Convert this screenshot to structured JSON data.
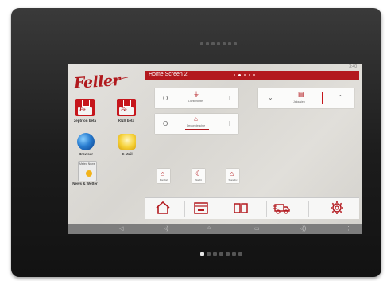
{
  "device": {
    "status_clock": "3:40"
  },
  "launcher": {
    "logo_text": "Feller",
    "apps": [
      {
        "name": "zeptrion beta",
        "icon": "feller-home-app-icon"
      },
      {
        "name": "KNX beta",
        "icon": "feller-home-app-icon"
      },
      {
        "name": "Browser",
        "icon": "globe-icon"
      },
      {
        "name": "E-Mail",
        "icon": "mail-icon"
      },
      {
        "name": "News & Wetter",
        "icon": "weather-icon"
      }
    ],
    "weather_widget_caption": "Meteo News"
  },
  "home_screen": {
    "title": "Home Screen 2",
    "page_count": 5,
    "active_page": 2,
    "colors": {
      "accent": "#b3191e",
      "header": "#b3191e"
    },
    "light_cards": [
      {
        "off_symbol": "O",
        "on_symbol": "I",
        "label": "Lichterkette",
        "icon": "light-fixture-icon"
      },
      {
        "off_symbol": "O",
        "on_symbol": "I",
        "label": "Deckenleuchte",
        "icon": "ceiling-lamp-icon"
      }
    ],
    "blind_card": {
      "down_symbol": "⌄",
      "up_symbol": "⌃",
      "label": "Jalousien",
      "icon": "blinds-icon"
    },
    "scenes": [
      {
        "label": "Komfort",
        "icon": "house-icon"
      },
      {
        "label": "Nacht",
        "icon": "moon-icon"
      },
      {
        "label": "Standby",
        "icon": "house-outline-icon"
      }
    ],
    "bottom_nav": [
      {
        "name": "home",
        "icon": "home-icon"
      },
      {
        "name": "calendar",
        "icon": "calendar-icon"
      },
      {
        "name": "book",
        "icon": "book-icon"
      },
      {
        "name": "delivery",
        "icon": "delivery-truck-icon"
      },
      {
        "name": "settings",
        "icon": "gear-icon"
      }
    ]
  },
  "system_nav": [
    {
      "name": "back",
      "icon": "back-arrow-icon"
    },
    {
      "name": "volume down",
      "icon": "volume-down-icon"
    },
    {
      "name": "home",
      "icon": "home-outline-icon"
    },
    {
      "name": "recents",
      "icon": "recents-icon"
    },
    {
      "name": "volume up",
      "icon": "volume-up-icon"
    },
    {
      "name": "menu",
      "icon": "menu-dots-icon"
    }
  ]
}
